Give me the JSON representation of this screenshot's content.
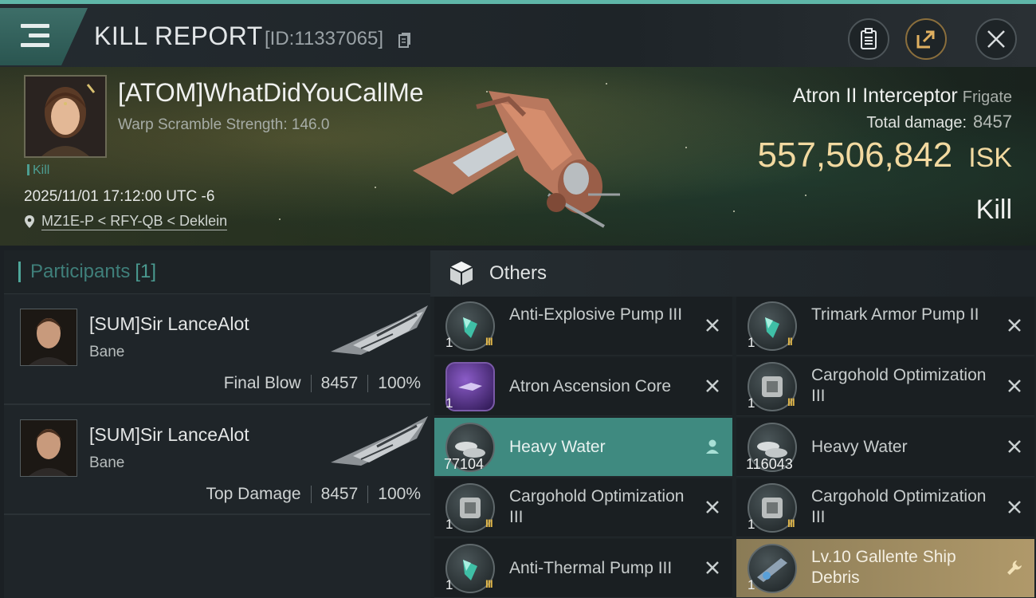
{
  "header": {
    "title": "KILL REPORT",
    "id_label": "[ID:11337065]"
  },
  "victim": {
    "name": "[ATOM]WhatDidYouCallMe",
    "warp_scramble": "Warp Scramble Strength: 146.0",
    "kill_tag": "Kill",
    "datetime": "2025/11/01 17:12:00 UTC -6",
    "location": "MZ1E-P < RFY-QB < Deklein",
    "ship_name": "Atron II Interceptor",
    "ship_class": "Frigate",
    "total_damage_label": "Total damage:",
    "total_damage_value": "8457",
    "isk_value": "557,506,842",
    "isk_unit": "ISK",
    "result": "Kill"
  },
  "participants": {
    "title": "Participants",
    "count": "[1]",
    "list": [
      {
        "name": "[SUM]Sir LanceAlot",
        "ship": "Bane",
        "role": "Final Blow",
        "damage": "8457",
        "percent": "100%"
      },
      {
        "name": "[SUM]Sir LanceAlot",
        "ship": "Bane",
        "role": "Top Damage",
        "damage": "8457",
        "percent": "100%"
      }
    ]
  },
  "items": {
    "title": "Others",
    "list": [
      {
        "name": "Anti-Explosive Pump III",
        "qty": "1",
        "meta": "III",
        "action": "destroyed"
      },
      {
        "name": "Trimark Armor Pump II",
        "qty": "1",
        "meta": "II",
        "action": "destroyed"
      },
      {
        "name": "Atron Ascension Core",
        "qty": "1",
        "meta": "",
        "action": "destroyed"
      },
      {
        "name": "Cargohold Optimization III",
        "qty": "1",
        "meta": "III",
        "action": "destroyed"
      },
      {
        "name": "Heavy Water",
        "qty": "77104",
        "meta": "",
        "action": "dropped"
      },
      {
        "name": "Heavy Water",
        "qty": "116043",
        "meta": "",
        "action": "destroyed"
      },
      {
        "name": "Cargohold Optimization III",
        "qty": "1",
        "meta": "III",
        "action": "destroyed"
      },
      {
        "name": "Cargohold Optimization III",
        "qty": "1",
        "meta": "III",
        "action": "destroyed"
      },
      {
        "name": "Anti-Thermal Pump III",
        "qty": "1",
        "meta": "III",
        "action": "destroyed"
      },
      {
        "name": "Lv.10 Gallente Ship Debris",
        "qty": "1",
        "meta": "",
        "action": "salvage"
      }
    ]
  },
  "colors": {
    "accent_teal": "#4fa79b",
    "isk_gold": "#f2d9a0",
    "highlight_row": "#3f8a80",
    "meta_gold": "#e0b64a"
  }
}
